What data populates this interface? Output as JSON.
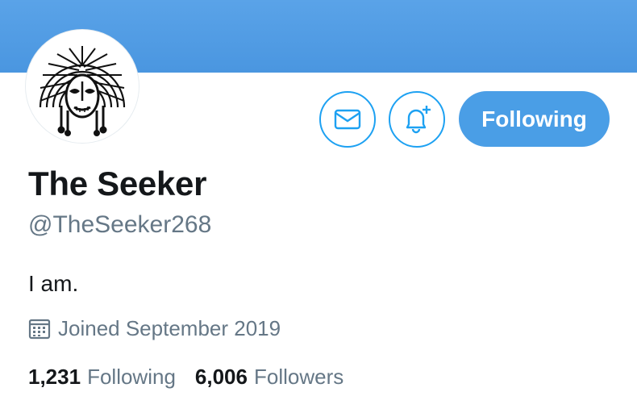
{
  "colors": {
    "accent": "#1da1f2",
    "follow_button_bg": "#4a9ee6",
    "banner_top": "#5aa3e8",
    "banner_bottom": "#4a96e0",
    "text_primary": "#14171a",
    "text_secondary": "#657786"
  },
  "profile": {
    "display_name": "The Seeker",
    "handle": "@TheSeeker268",
    "bio": "I am.",
    "joined": "Joined September 2019",
    "avatar_icon": "tribal-mask-avatar"
  },
  "actions": {
    "message_icon": "envelope-icon",
    "notify_icon": "bell-plus-icon",
    "follow_label": "Following"
  },
  "stats": {
    "following_count": "1,231",
    "following_label": "Following",
    "followers_count": "6,006",
    "followers_label": "Followers"
  }
}
